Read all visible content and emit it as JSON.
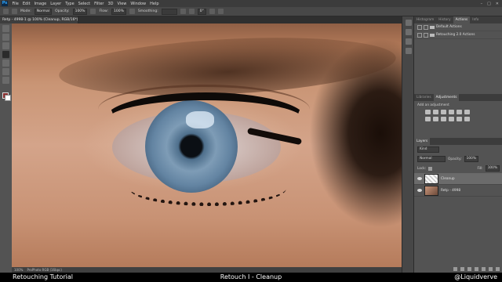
{
  "menu": {
    "logo": "Ps",
    "items": [
      "File",
      "Edit",
      "Image",
      "Layer",
      "Type",
      "Select",
      "Filter",
      "3D",
      "View",
      "Window",
      "Help"
    ]
  },
  "options": {
    "mode_label": "Mode:",
    "mode_value": "Normal",
    "opacity_label": "Opacity:",
    "opacity_value": "100%",
    "flow_label": "Flow:",
    "flow_value": "100%",
    "smoothing_label": "Smoothing:",
    "angle_value": "0°"
  },
  "document": {
    "tab": "Retp - 4998-1 @ 100% (Cleanup, RGB/16*) *"
  },
  "status": {
    "zoom": "100%",
    "profile": "ProPhoto RGB (16bpc)"
  },
  "panels": {
    "top_tabs": [
      "Histogram",
      "History",
      "Actions",
      "Info"
    ],
    "top_active": "Actions",
    "actions": [
      "Default Actions",
      "Retouching 2.0 Actions"
    ],
    "adj_tabs": [
      "Libraries",
      "Adjustments"
    ],
    "adj_active": "Adjustments",
    "adj_add": "Add an adjustment",
    "layers_tab": "Layers",
    "kind_label": "Kind",
    "blend_mode": "Normal",
    "opacity_label": "Opacity:",
    "opacity_value": "100%",
    "lock_label": "Lock:",
    "fill_label": "Fill:",
    "fill_value": "100%",
    "layers": [
      {
        "name": "Cleanup",
        "selected": true
      },
      {
        "name": "Retp - 4998",
        "selected": false
      }
    ]
  },
  "caption": {
    "left": "Retouching Tutorial",
    "middle": "Retouch I - Cleanup",
    "right": "@Liquidverve"
  },
  "colors": {
    "ui_bg": "#535353",
    "menubar": "#3c3c3c",
    "foreground_swatch": "#8a2e2e",
    "background_swatch": "#ffffff"
  }
}
